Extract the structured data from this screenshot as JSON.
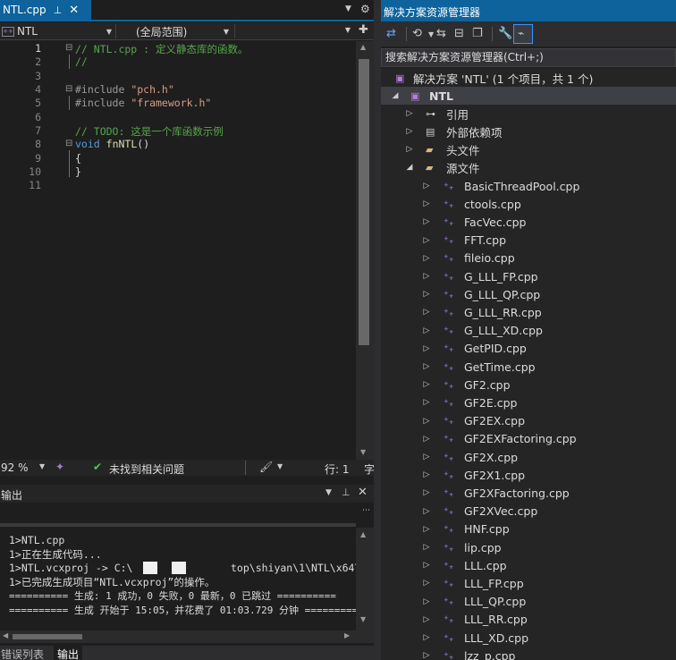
{
  "editor": {
    "tab_title": "NTL.cpp",
    "pin_glyph": "⊥",
    "close_glyph": "✕",
    "project_combo": "NTL",
    "scope_combo": "(全局范围)",
    "lines": [
      {
        "n": "1",
        "text": "// NTL.cpp : 定义静态库的函数。"
      },
      {
        "n": "2",
        "text": "//"
      },
      {
        "n": "3",
        "text": ""
      },
      {
        "n": "4",
        "text": "#include \"pch.h\""
      },
      {
        "n": "5",
        "text": "#include \"framework.h\""
      },
      {
        "n": "6",
        "text": ""
      },
      {
        "n": "7",
        "text": "// TODO: 这是一个库函数示例"
      },
      {
        "n": "8",
        "text": "void fnNTL()"
      },
      {
        "n": "9",
        "text": "{"
      },
      {
        "n": "10",
        "text": "}"
      },
      {
        "n": "11",
        "text": ""
      }
    ],
    "zoom": "92 %",
    "issues": "未找到相关问题",
    "line_pos": "行: 1",
    "encoding_cut": "字"
  },
  "output": {
    "title": "输出",
    "lines": [
      "1>NTL.cpp",
      "1>正在生成代码...",
      "1>NTL.vcxproj -> C:\\",
      "1>已完成生成项目“NTL.vcxproj”的操作。",
      "========== 生成: 1 成功，0 失败，0 最新，0 已跳过 ==========",
      "========== 生成 开始于 15:05，并花费了 01:03.729 分钟 =========="
    ],
    "path_tail": "top\\shiyan\\1\\NTL\\x64\\",
    "tabs": [
      "错误列表",
      "输出"
    ]
  },
  "solution_explorer": {
    "title": "解决方案资源管理器",
    "search_placeholder": "搜索解决方案资源管理器(Ctrl+;)",
    "solution_label": "解决方案 'NTL' (1 个项目，共 1 个)",
    "project": "NTL",
    "nodes": [
      "引用",
      "外部依赖项",
      "头文件",
      "源文件"
    ],
    "files": [
      "BasicThreadPool.cpp",
      "ctools.cpp",
      "FacVec.cpp",
      "FFT.cpp",
      "fileio.cpp",
      "G_LLL_FP.cpp",
      "G_LLL_QP.cpp",
      "G_LLL_RR.cpp",
      "G_LLL_XD.cpp",
      "GetPID.cpp",
      "GetTime.cpp",
      "GF2.cpp",
      "GF2E.cpp",
      "GF2EX.cpp",
      "GF2EXFactoring.cpp",
      "GF2X.cpp",
      "GF2X1.cpp",
      "GF2XFactoring.cpp",
      "GF2XVec.cpp",
      "HNF.cpp",
      "lip.cpp",
      "LLL.cpp",
      "LLL_FP.cpp",
      "LLL_QP.cpp",
      "LLL_RR.cpp",
      "LLL_XD.cpp",
      "lzz_p.cpp"
    ]
  }
}
